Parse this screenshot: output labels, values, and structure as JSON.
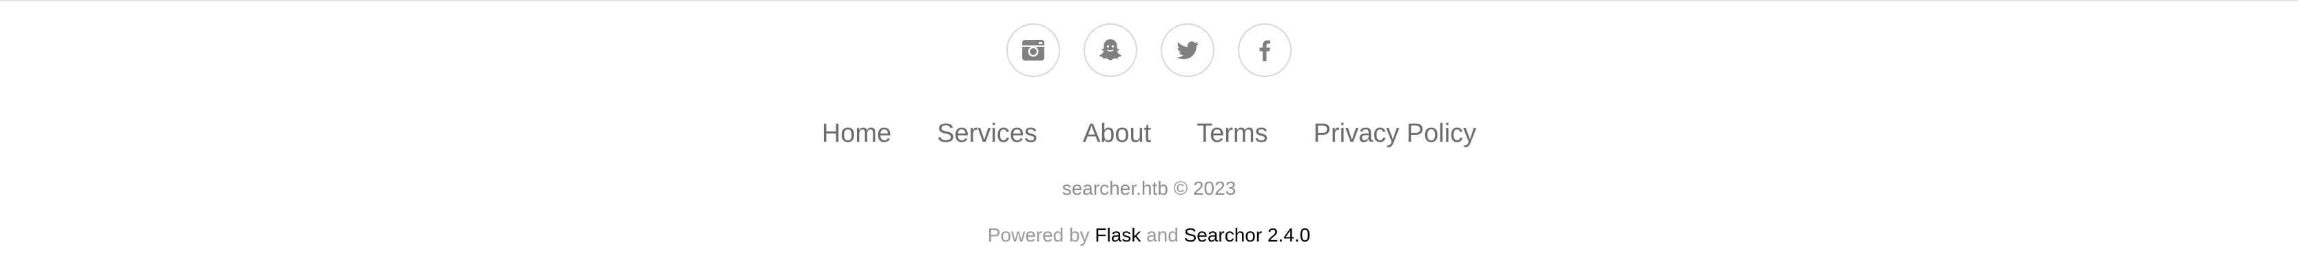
{
  "social": {
    "items": [
      {
        "icon": "instagram-icon",
        "name": "social-instagram-button"
      },
      {
        "icon": "snapchat-icon",
        "name": "social-snapchat-button"
      },
      {
        "icon": "twitter-icon",
        "name": "social-twitter-button"
      },
      {
        "icon": "facebook-icon",
        "name": "social-facebook-button"
      }
    ],
    "icon_color": "#808080",
    "border_color": "#d7d7d7"
  },
  "nav": {
    "home": "Home",
    "services": "Services",
    "about": "About",
    "terms": "Terms",
    "privacy": "Privacy Policy"
  },
  "copyright": "searcher.htb © 2023",
  "powered": {
    "prefix": "Powered by",
    "flask": "Flask",
    "and": "and",
    "searchor": "Searchor 2.4.0"
  }
}
